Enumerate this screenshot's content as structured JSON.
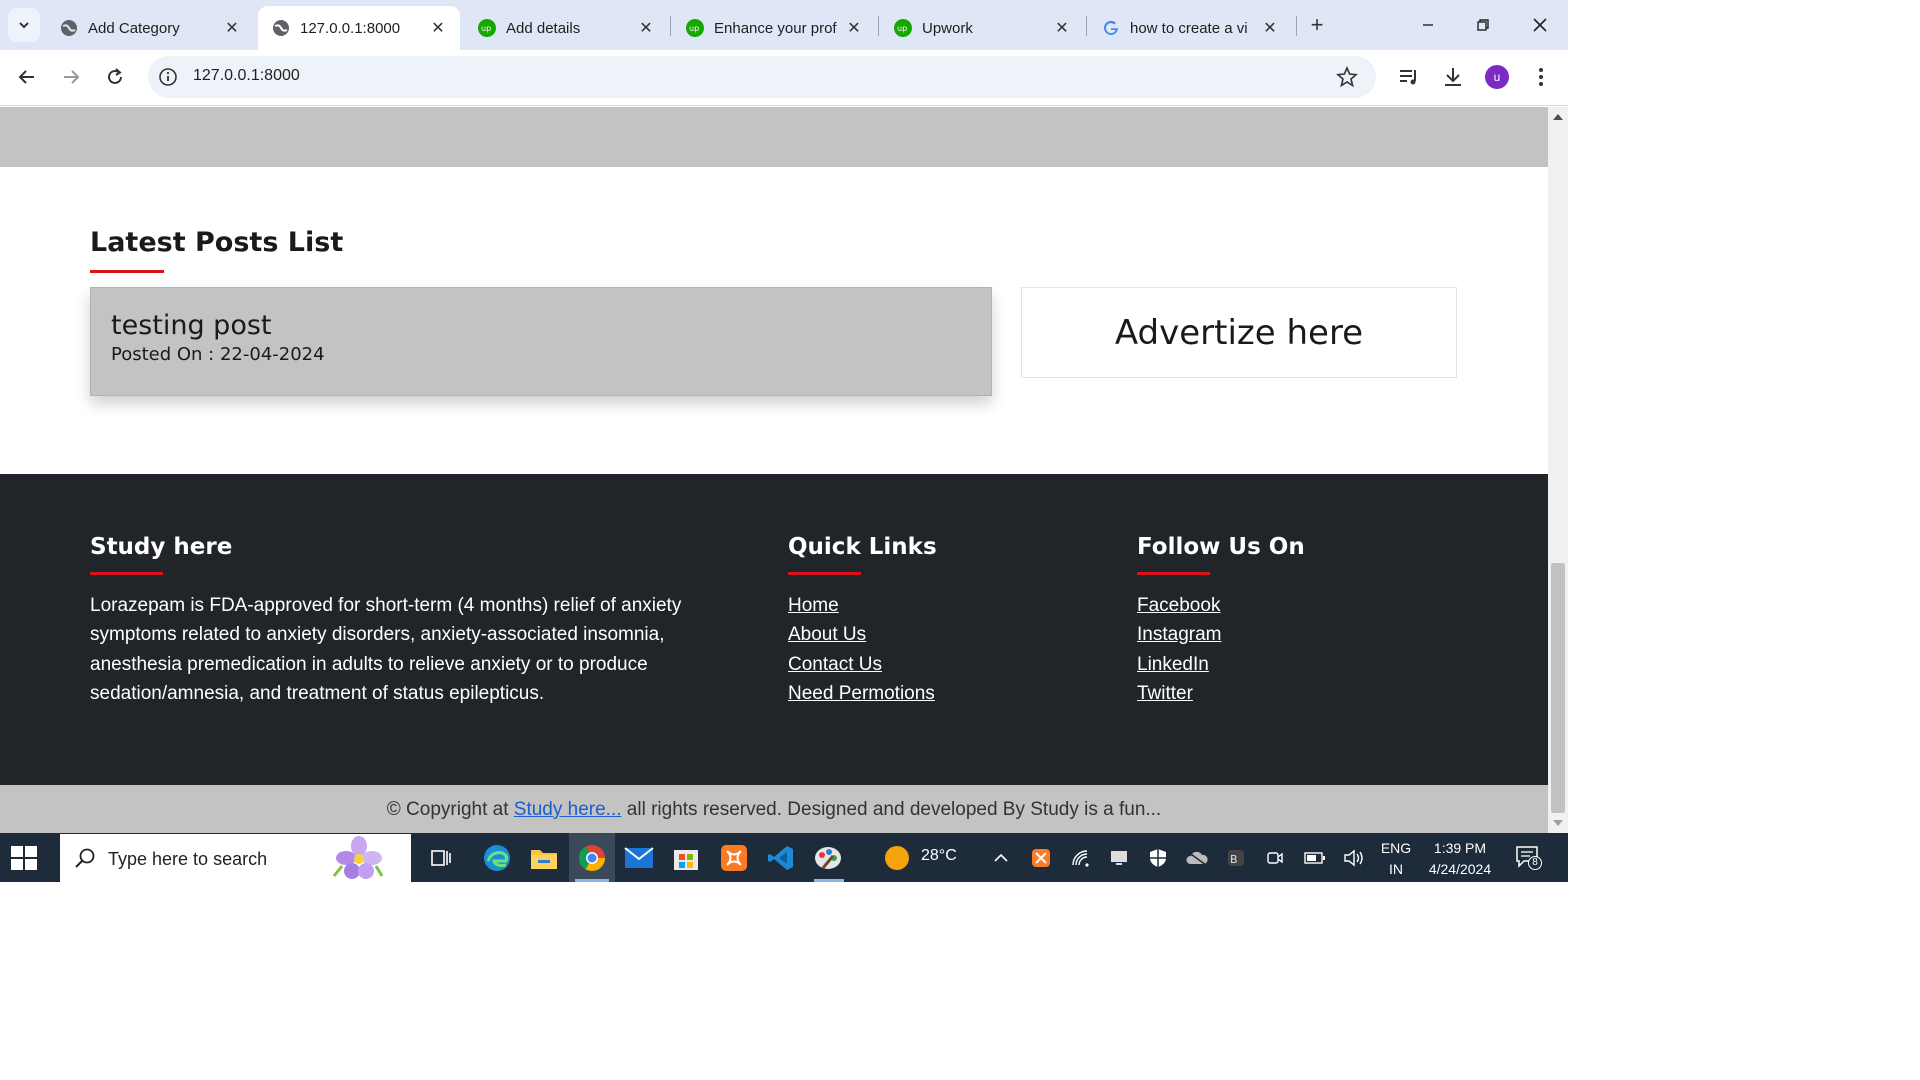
{
  "browser": {
    "tabs": [
      {
        "label": "Add Category",
        "icon": "globe-icon",
        "active": false
      },
      {
        "label": "127.0.0.1:8000",
        "icon": "globe-icon",
        "active": true
      },
      {
        "label": "Add details",
        "icon": "upwork-icon",
        "active": false
      },
      {
        "label": "Enhance your prof",
        "icon": "upwork-icon",
        "active": false
      },
      {
        "label": "Upwork",
        "icon": "upwork-icon",
        "active": false
      },
      {
        "label": "how to create a vi",
        "icon": "google-icon",
        "active": false
      }
    ],
    "url": "127.0.0.1:8000",
    "profile_initial": "u"
  },
  "page": {
    "latest_title": "Latest Posts List",
    "post": {
      "title": "testing post",
      "date": "Posted On : 22-04-2024"
    },
    "ad_text": "Advertize here",
    "footer": {
      "about_title": "Study here",
      "about_text": "Lorazepam is FDA-approved for short-term (4 months) relief of anxiety symptoms related to anxiety disorders, anxiety-associated insomnia, anesthesia premedication in adults to relieve anxiety or to produce sedation/amnesia, and treatment of status epilepticus.",
      "quick_links_title": "Quick Links",
      "quick_links": [
        "Home",
        "About Us",
        "Contact Us",
        "Need Permotions"
      ],
      "follow_title": "Follow Us On",
      "follow_links": [
        "Facebook",
        "Instagram",
        "LinkedIn",
        "Twitter"
      ]
    },
    "copyright": {
      "prefix": "© Copyright at ",
      "link": "Study here...",
      "suffix": " all rights reserved. Designed and developed By Study is a fun..."
    }
  },
  "taskbar": {
    "search_placeholder": "Type here to search",
    "weather": "28°C",
    "language": "ENG",
    "region": "IN",
    "time": "1:39 PM",
    "date": "4/24/2024",
    "notifications": "8"
  },
  "colors": {
    "accent_red": "#d8141a",
    "footer_bg": "#212529",
    "band_grey": "#c4c3c2",
    "link_blue": "#1a5fd1"
  }
}
